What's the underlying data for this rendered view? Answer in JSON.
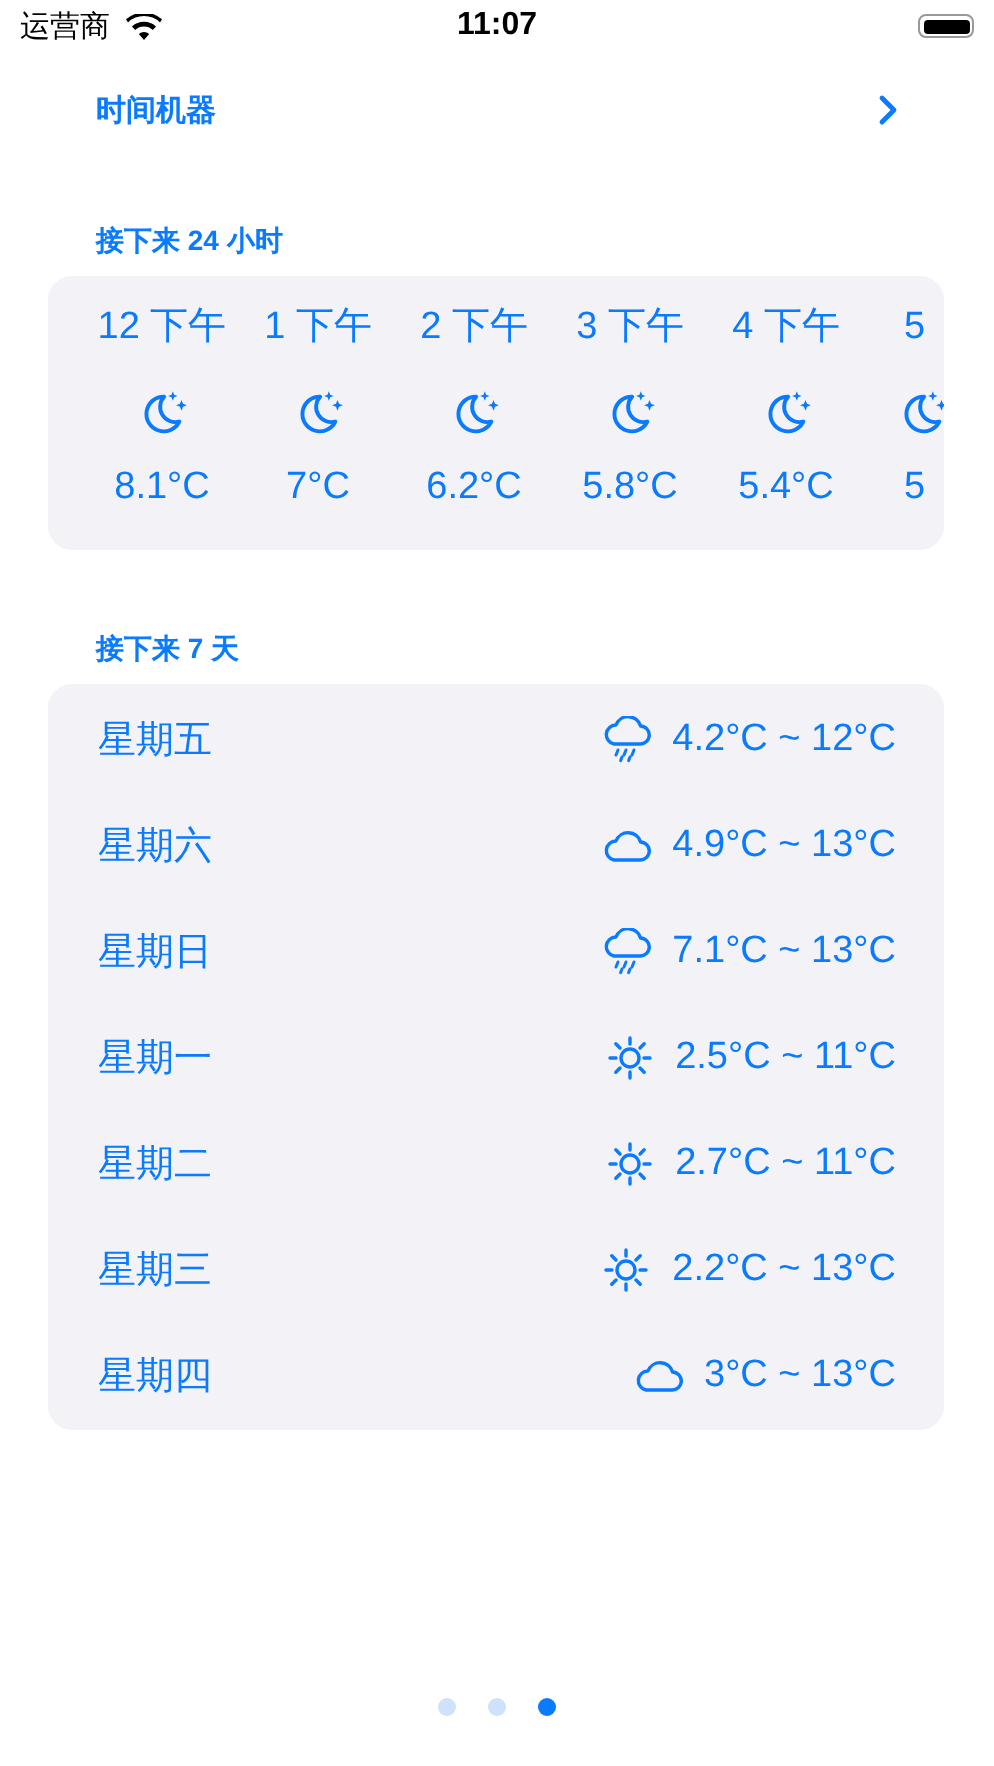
{
  "status_bar": {
    "carrier": "运营商",
    "time": "11:07"
  },
  "time_machine": {
    "label": "时间机器"
  },
  "hourly": {
    "title": "接下来 24 小时",
    "hours": [
      {
        "time": "12 下午",
        "kind": "moon",
        "temp": "8.1°C",
        "cut": false
      },
      {
        "time": "1 下午",
        "kind": "moon",
        "temp": "7°C",
        "cut": false
      },
      {
        "time": "2 下午",
        "kind": "moon",
        "temp": "6.2°C",
        "cut": false
      },
      {
        "time": "3 下午",
        "kind": "moon",
        "temp": "5.8°C",
        "cut": false
      },
      {
        "time": "4 下午",
        "kind": "moon",
        "temp": "5.4°C",
        "cut": false
      },
      {
        "time": "5",
        "kind": "moon",
        "temp": "5",
        "cut": true
      }
    ]
  },
  "daily": {
    "title": "接下来 7 天",
    "days": [
      {
        "day": "星期五",
        "kind": "rain",
        "range": "4.2°C ~ 12°C"
      },
      {
        "day": "星期六",
        "kind": "cloud",
        "range": "4.9°C ~ 13°C"
      },
      {
        "day": "星期日",
        "kind": "rain",
        "range": "7.1°C ~ 13°C"
      },
      {
        "day": "星期一",
        "kind": "sun",
        "range": "2.5°C ~ 11°C"
      },
      {
        "day": "星期二",
        "kind": "sun",
        "range": "2.7°C ~ 11°C"
      },
      {
        "day": "星期三",
        "kind": "sun",
        "range": "2.2°C ~ 13°C"
      },
      {
        "day": "星期四",
        "kind": "cloud",
        "range": "3°C ~ 13°C"
      }
    ]
  },
  "pager": [
    {
      "selected": false
    },
    {
      "selected": false
    },
    {
      "selected": true
    }
  ]
}
